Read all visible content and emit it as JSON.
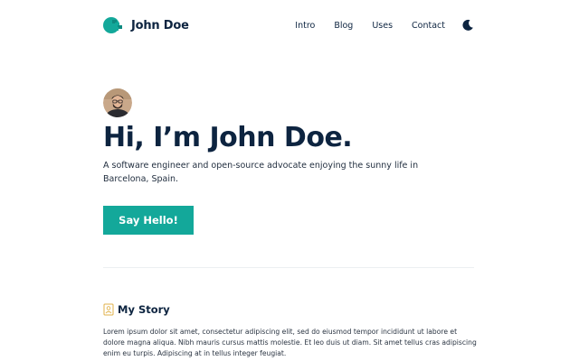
{
  "brand": {
    "name": "John Doe",
    "logo_icon": "logo-mark-icon"
  },
  "nav": {
    "items": [
      {
        "label": "Intro"
      },
      {
        "label": "Blog"
      },
      {
        "label": "Uses"
      },
      {
        "label": "Contact"
      }
    ],
    "theme_icon": "moon-icon"
  },
  "hero": {
    "title": "Hi, I’m John Doe.",
    "description": "A software engineer and open-source advocate enjoying the sunny life in Barcelona, Spain.",
    "cta_label": "Say Hello!"
  },
  "story": {
    "title": "My Story",
    "icon": "contact-card-icon",
    "body": "Lorem ipsum dolor sit amet, consectetur adipiscing elit, sed do eiusmod tempor incididunt ut labore et dolore magna aliqua. Nibh mauris cursus mattis molestie. Et leo duis ut diam. Sit amet tellus cras adipiscing enim eu turpis. Adipiscing at in tellus integer feugiat."
  },
  "colors": {
    "accent": "#13a89a",
    "heading": "#0d2440",
    "icon_amber": "#e0b24a"
  }
}
